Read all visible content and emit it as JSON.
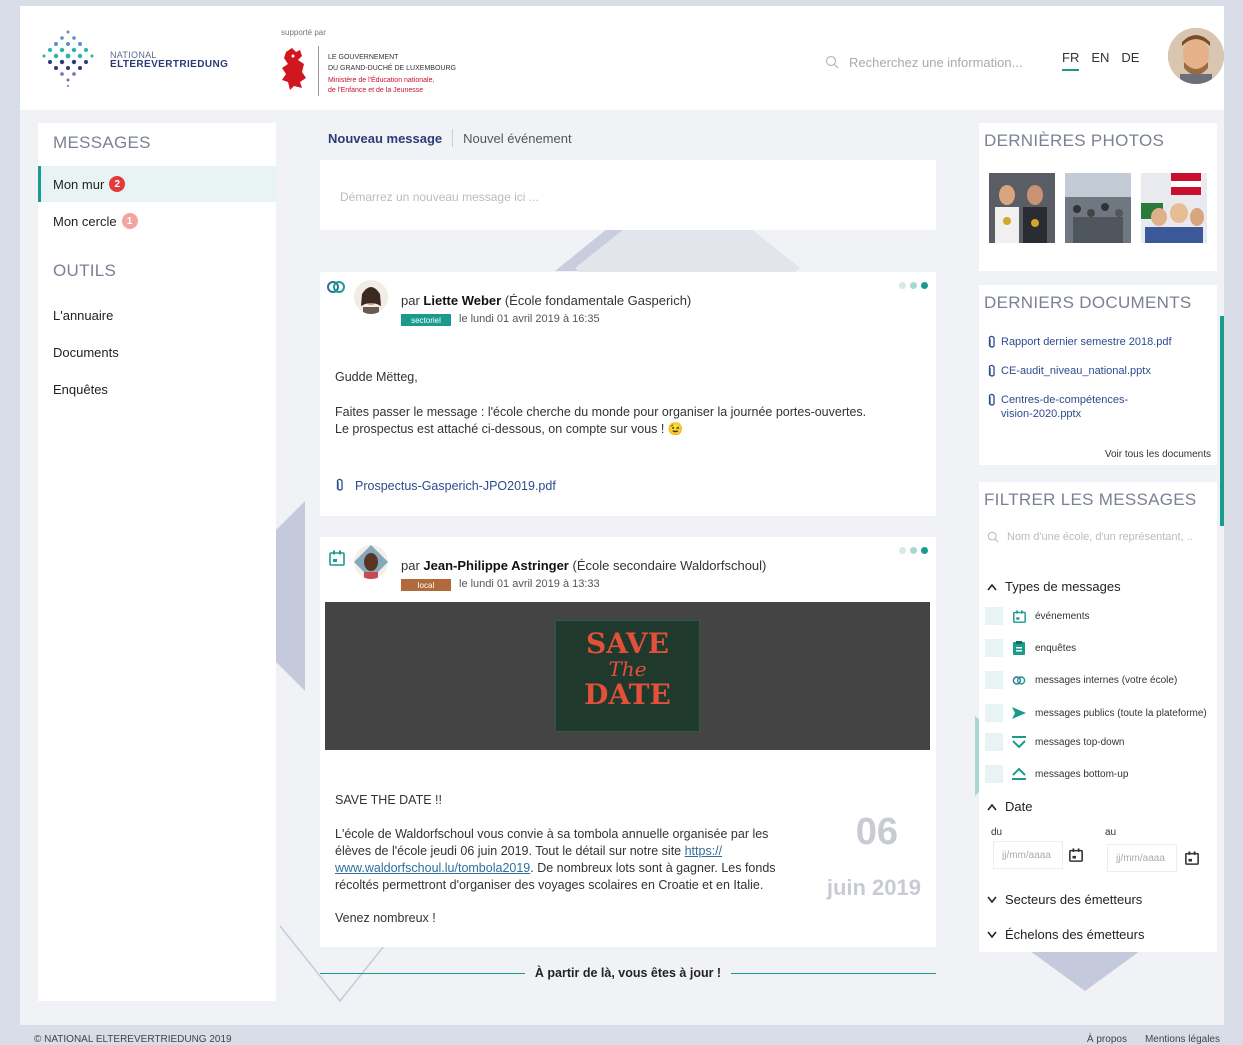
{
  "header": {
    "logo_line1": "NATIONAL",
    "logo_line2": "ELTEREVERTRIEDUNG",
    "supported_by": "supporté par",
    "gov_line1": "LE GOUVERNEMENT",
    "gov_line2": "DU GRAND-DUCHÉ DE LUXEMBOURG",
    "gov_line3": "Ministère de l'Éducation nationale,",
    "gov_line4": "de l'Enfance et de la Jeunesse",
    "search_placeholder": "Recherchez une information...",
    "languages": [
      "FR",
      "EN",
      "DE"
    ],
    "active_language": "FR"
  },
  "sidebar": {
    "messages_heading": "MESSAGES",
    "items": [
      {
        "label": "Mon mur",
        "badge": "2"
      },
      {
        "label": "Mon cercle",
        "badge": "1"
      }
    ],
    "tools_heading": "OUTILS",
    "tools": [
      "L'annuaire",
      "Documents",
      "Enquêtes"
    ]
  },
  "composer": {
    "tab_new_message": "Nouveau message",
    "tab_new_event": "Nouvel événement",
    "placeholder": "Démarrez un nouveau message ici ..."
  },
  "posts": [
    {
      "by_prefix": "par",
      "author": "Liette Weber",
      "org": "(École fondamentale Gasperich)",
      "tag": "sectoriel",
      "tag_color": "#1a9b8e",
      "date": "le lundi 01 avril 2019 à 16:35",
      "greeting": "Gudde Mëtteg,",
      "line1": "Faites passer le message : l'école cherche du monde pour organiser la journée portes-ouvertes.",
      "line2": "Le prospectus est attaché ci-dessous, on compte sur vous ! 😉",
      "attachment": "Prospectus-Gasperich-JPO2019.pdf"
    },
    {
      "by_prefix": "par",
      "author": "Jean-Philippe Astringer",
      "org": "(École secondaire Waldorfschoul)",
      "tag": "local",
      "tag_color": "#b06a3b",
      "date": "le lundi 01 avril 2019 à 13:33",
      "image_text1": "SAVE",
      "image_text2": "The",
      "image_text3": "DATE",
      "title": "SAVE THE DATE !!",
      "p1_line1": "L'école de Waldorfschoul vous convie à sa tombola annuelle organisée par les",
      "p1_line2a": "élèves de l'école jeudi 06 juin 2019. Tout le détail sur notre site ",
      "link_part1": "https://",
      "link_part2": "www.waldorfschoul.lu/tombola2019",
      "p1_line3b": ". De nombreux lots sont à gagner. Les fonds",
      "p1_line4": "récoltés permettront d'organiser des voyages scolaires en Croatie et en Italie.",
      "closing": "Venez nombreux !",
      "event_day": "06",
      "event_month": "juin 2019"
    }
  ],
  "end_message": "À partir de là, vous êtes à jour !",
  "right": {
    "photos_heading": "DERNIÈRES PHOTOS",
    "documents_heading": "DERNIERS DOCUMENTS",
    "documents": [
      "Rapport dernier semestre 2018.pdf",
      "CE-audit_niveau_national.pptx",
      "Centres-de-compétences-",
      "vision-2020.pptx"
    ],
    "see_all_documents": "Voir tous les documents",
    "filter_heading": "FILTRER LES MESSAGES",
    "filter_placeholder": "Nom d'une école, d'un représentant, ...",
    "types_heading": "Types de messages",
    "types": [
      "événements",
      "enquêtes",
      "messages internes (votre école)",
      "messages publics (toute la plateforme)",
      "messages top-down",
      "messages bottom-up"
    ],
    "date_heading": "Date",
    "date_from": "du",
    "date_to": "au",
    "date_placeholder": "jj/mm/aaaa",
    "sectors_heading": "Secteurs des émetteurs",
    "levels_heading": "Échelons des émetteurs"
  },
  "footer": {
    "copyright": "© NATIONAL ELTEREVERTRIEDUNG 2019",
    "about": "À propos",
    "legal": "Mentions légales"
  },
  "colors": {
    "accent": "#1a9b8e",
    "navy": "#2e3a78",
    "badge_red": "#e23b3b"
  }
}
